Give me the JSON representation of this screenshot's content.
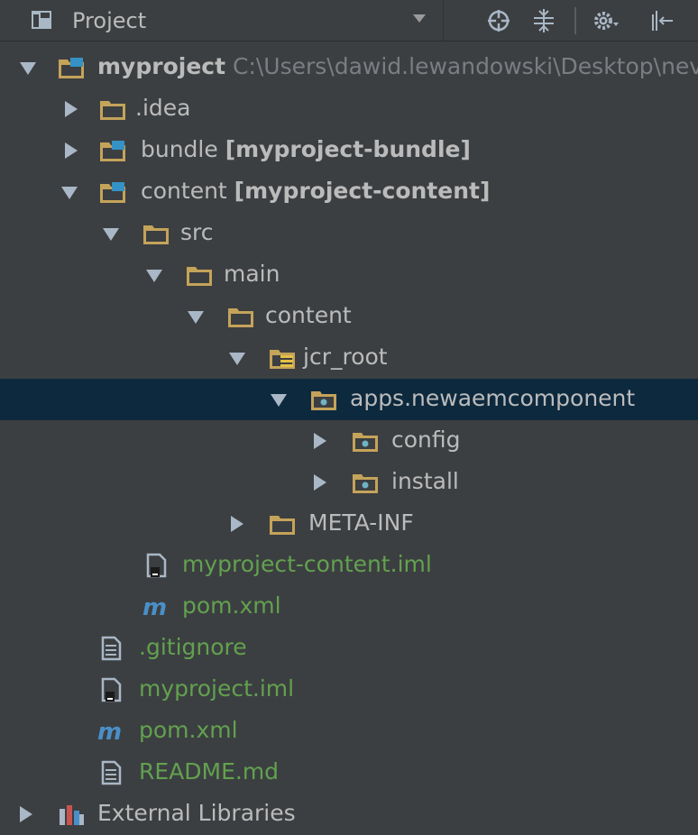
{
  "toolbar": {
    "title": "Project",
    "icons": [
      "target-icon",
      "collapse-all-icon",
      "gear-icon",
      "hide-icon"
    ]
  },
  "colors": {
    "background": "#3c3f41",
    "selection": "#0d293e",
    "text": "#bbbbbb",
    "vcs_added_green": "#62a14f",
    "folder": "#c4a35a",
    "muted_path": "#7a7e82"
  },
  "tree": {
    "root": {
      "name": "myproject",
      "path": "C:\\Users\\dawid.lewandowski\\Desktop\\nev"
    },
    "items": [
      {
        "name": ".idea",
        "icon": "folder-icon"
      },
      {
        "name": "bundle",
        "module": "[myproject-bundle]",
        "icon": "module-folder-icon"
      },
      {
        "name": "content",
        "module": "[myproject-content]",
        "icon": "module-folder-icon"
      },
      {
        "name": "src",
        "icon": "folder-icon"
      },
      {
        "name": "main",
        "icon": "folder-icon"
      },
      {
        "name": "content",
        "icon": "folder-icon"
      },
      {
        "name": "jcr_root",
        "icon": "resource-root-folder-icon"
      },
      {
        "name": "apps.newaemcomponent",
        "icon": "package-folder-icon"
      },
      {
        "name": "config",
        "icon": "package-folder-icon"
      },
      {
        "name": "install",
        "icon": "package-folder-icon"
      },
      {
        "name": "META-INF",
        "icon": "folder-icon"
      },
      {
        "name": "myproject-content.iml",
        "icon": "iml-file-icon"
      },
      {
        "name": "pom.xml",
        "icon": "maven-icon"
      },
      {
        "name": ".gitignore",
        "icon": "text-file-icon"
      },
      {
        "name": "myproject.iml",
        "icon": "iml-file-icon"
      },
      {
        "name": "pom.xml",
        "icon": "maven-icon"
      },
      {
        "name": "README.md",
        "icon": "text-file-icon"
      },
      {
        "name": "External Libraries",
        "icon": "libraries-icon"
      }
    ]
  }
}
